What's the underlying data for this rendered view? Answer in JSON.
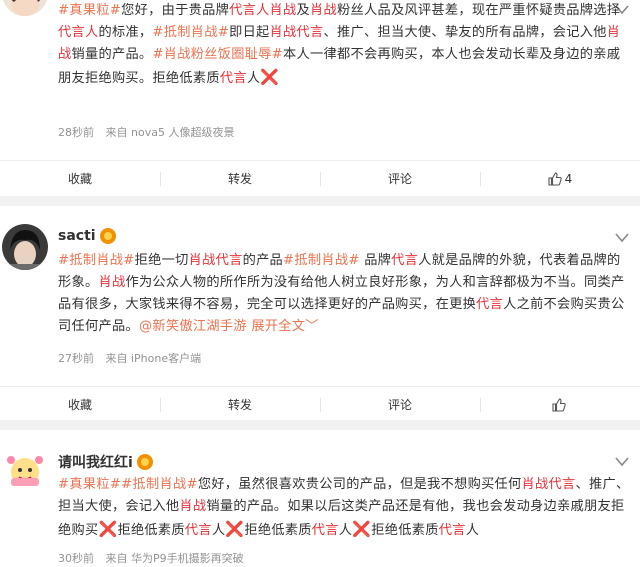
{
  "posts": [
    {
      "username": "",
      "text_segments": [
        {
          "t": "#真果粒#",
          "c": "tag"
        },
        {
          "t": "您好，由于贵品牌",
          "c": ""
        },
        {
          "t": "代言人",
          "c": "hl"
        },
        {
          "t": "肖战",
          "c": "hl"
        },
        {
          "t": "及",
          "c": ""
        },
        {
          "t": "肖战",
          "c": "hl"
        },
        {
          "t": "粉丝人品及风评甚差，现在严重怀疑贵品牌选择",
          "c": ""
        },
        {
          "t": "代言人",
          "c": "hl"
        },
        {
          "t": "的标准，",
          "c": ""
        },
        {
          "t": "#抵制肖战#",
          "c": "tag"
        },
        {
          "t": "即日起",
          "c": ""
        },
        {
          "t": "肖战",
          "c": "hl"
        },
        {
          "t": "代言",
          "c": "hl"
        },
        {
          "t": "、推广、担当大使、挚友的所有品牌，会记入他",
          "c": ""
        },
        {
          "t": "肖战",
          "c": "hl"
        },
        {
          "t": "销量的产品。",
          "c": ""
        },
        {
          "t": "#肖战粉丝饭圈耻辱#",
          "c": "tag"
        },
        {
          "t": "本人一律都不会再购买，本人也会发动长辈及身边的亲戚朋友拒绝购买。拒绝低素质",
          "c": ""
        },
        {
          "t": "代言",
          "c": "hl"
        },
        {
          "t": "人",
          "c": ""
        },
        {
          "t": "❌",
          "c": "x"
        }
      ],
      "time": "28秒前",
      "source": "来自 nova5 人像超级夜景",
      "actions": {
        "fav": "收藏",
        "repost": "转发",
        "comment": "评论",
        "likes": "4"
      }
    },
    {
      "username": "sacti",
      "text_segments": [
        {
          "t": "#抵制肖战#",
          "c": "tag"
        },
        {
          "t": "拒绝一切",
          "c": ""
        },
        {
          "t": "肖战",
          "c": "hl"
        },
        {
          "t": "代言",
          "c": "hl"
        },
        {
          "t": "的产品",
          "c": ""
        },
        {
          "t": "#抵制肖战#",
          "c": "tag"
        },
        {
          "t": " 品牌",
          "c": ""
        },
        {
          "t": "代言",
          "c": "hl"
        },
        {
          "t": "人就是品牌的外貌，代表着品牌的形象。",
          "c": ""
        },
        {
          "t": "肖战",
          "c": "hl"
        },
        {
          "t": "作为公众人物的所作所为没有给他人树立良好形象，为人和言辞都极为不当。同类产品有很多，大家钱来得不容易，完全可以选择更好的产品购买，在更换",
          "c": ""
        },
        {
          "t": "代言",
          "c": "hl"
        },
        {
          "t": "人之前不会购买贵公司任何产品。",
          "c": ""
        },
        {
          "t": "@新笑傲江湖手游",
          "c": "link"
        },
        {
          "t": " 展开全文﹀",
          "c": "link"
        }
      ],
      "time": "27秒前",
      "source": "来自 iPhone客户端",
      "actions": {
        "fav": "收藏",
        "repost": "转发",
        "comment": "评论",
        "likes": ""
      }
    },
    {
      "username": "请叫我红红i",
      "text_segments": [
        {
          "t": "#真果粒#",
          "c": "tag"
        },
        {
          "t": "#抵制肖战#",
          "c": "tag"
        },
        {
          "t": "您好，虽然很喜欢贵公司的产品，但是我不想购买任何",
          "c": ""
        },
        {
          "t": "肖战",
          "c": "hl"
        },
        {
          "t": "代言",
          "c": "hl"
        },
        {
          "t": "、推广、担当大使，会记入他",
          "c": ""
        },
        {
          "t": "肖战",
          "c": "hl"
        },
        {
          "t": "销量的产品。如果以后这类产品还是有他，我也会发动身边亲戚朋友拒绝购买",
          "c": ""
        },
        {
          "t": "❌",
          "c": "x"
        },
        {
          "t": "拒绝低素质",
          "c": ""
        },
        {
          "t": "代言",
          "c": "hl"
        },
        {
          "t": "人",
          "c": ""
        },
        {
          "t": "❌",
          "c": "x"
        },
        {
          "t": "拒绝低素质",
          "c": ""
        },
        {
          "t": "代言",
          "c": "hl"
        },
        {
          "t": "人",
          "c": ""
        },
        {
          "t": "❌",
          "c": "x"
        },
        {
          "t": "拒绝低素质",
          "c": ""
        },
        {
          "t": "代言",
          "c": "hl"
        },
        {
          "t": "人",
          "c": ""
        }
      ],
      "time": "30秒前",
      "source": "来自 华为P9手机摄影再突破",
      "actions": null
    }
  ],
  "icons": {
    "more": "chevron-down-icon",
    "like": "thumb-up-icon",
    "verified": "verified-badge-icon"
  },
  "colors": {
    "highlight": "#e5323a",
    "tag": "#eb7350",
    "meta": "#939393"
  }
}
